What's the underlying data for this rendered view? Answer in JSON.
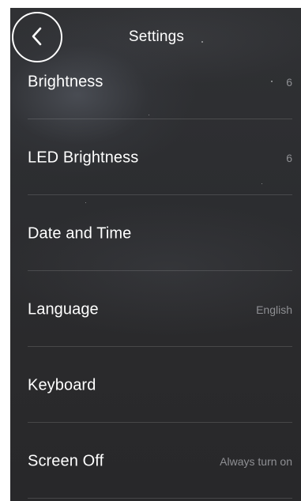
{
  "header": {
    "title": "Settings"
  },
  "settings": {
    "items": [
      {
        "label": "Brightness",
        "value": "6"
      },
      {
        "label": "LED Brightness",
        "value": "6"
      },
      {
        "label": "Date and Time",
        "value": ""
      },
      {
        "label": "Language",
        "value": "English"
      },
      {
        "label": "Keyboard",
        "value": ""
      },
      {
        "label": "Screen Off",
        "value": "Always turn on"
      }
    ]
  },
  "colors": {
    "background": "#2c2d30",
    "text": "#ffffff",
    "value_text": "#8e8f93",
    "back_button_ring": "#ffffff"
  },
  "icons": {
    "back": "chevron-left-icon"
  }
}
